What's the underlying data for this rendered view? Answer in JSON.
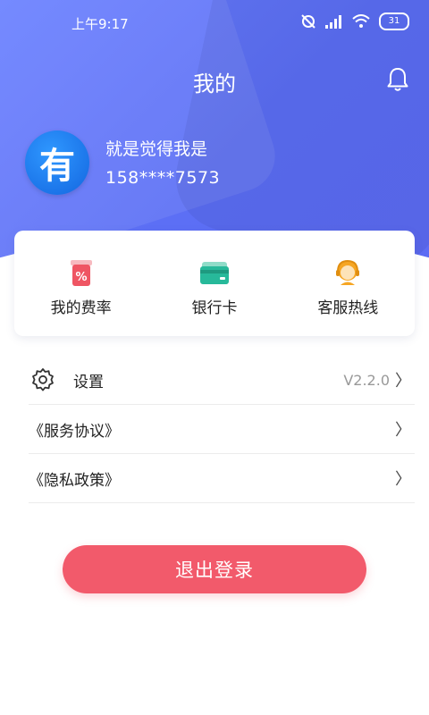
{
  "status": {
    "time": "上午9:17",
    "battery": "31"
  },
  "header": {
    "title": "我的"
  },
  "profile": {
    "avatar_char": "有",
    "name": "就是觉得我是",
    "phone": "158****7573"
  },
  "quick_actions": [
    {
      "label": "我的费率",
      "icon": "rate-icon"
    },
    {
      "label": "银行卡",
      "icon": "bank-card-icon"
    },
    {
      "label": "客服热线",
      "icon": "customer-service-icon"
    }
  ],
  "menu": {
    "settings_label": "设置",
    "version": "V2.2.0",
    "service_agreement": "《服务协议》",
    "privacy_policy": "《隐私政策》",
    "chevron": "〉"
  },
  "logout_label": "退出登录",
  "colors": {
    "header": "#5c6ff5",
    "logout": "#f25a6b",
    "card_green": "#27b99a",
    "rate_red": "#ef5563"
  }
}
